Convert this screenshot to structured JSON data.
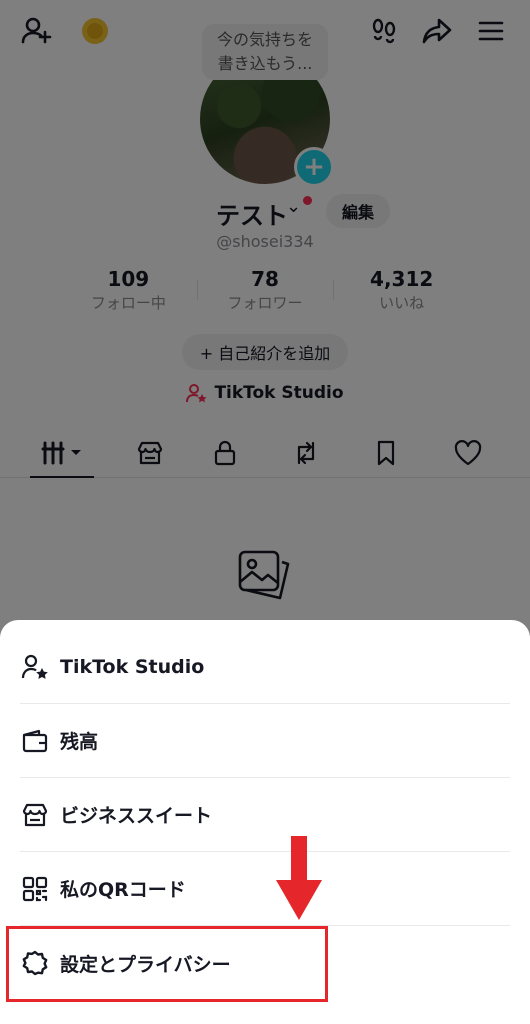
{
  "bubble": {
    "line1": "今の気持ちを",
    "line2": "書き込もう..."
  },
  "profile": {
    "name": "テスト",
    "chevron": "⌄",
    "edit_label": "編集",
    "handle": "@shosei334"
  },
  "stats": [
    {
      "value": "109",
      "label": "フォロー中"
    },
    {
      "value": "78",
      "label": "フォロワー"
    },
    {
      "value": "4,312",
      "label": "いいね"
    }
  ],
  "bio_button": "+ 自己紹介を追加",
  "studio_link": "TikTok Studio",
  "menu": [
    {
      "label": "TikTok Studio",
      "icon": "creator-icon"
    },
    {
      "label": "残高",
      "icon": "wallet-icon"
    },
    {
      "label": "ビジネススイート",
      "icon": "store-icon"
    },
    {
      "label": "私のQRコード",
      "icon": "qr-code-icon"
    },
    {
      "label": "設定とプライバシー",
      "icon": "gear-icon"
    }
  ],
  "colors": {
    "accent": "#fe2c55",
    "plus": "#20d5ec",
    "highlight": "#e5262b"
  }
}
